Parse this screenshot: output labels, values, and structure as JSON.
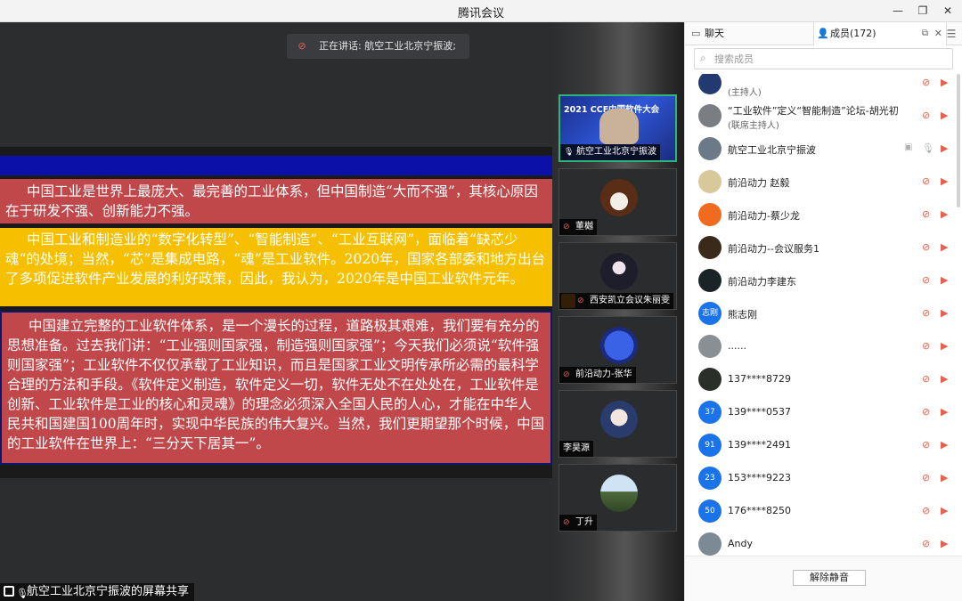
{
  "window": {
    "title": "腾讯会议"
  },
  "speaking": {
    "text": "正在讲话: 航空工业北京宁振波;"
  },
  "slide": {
    "p1": "中国工业是世界上最庞大、最完善的工业体系，但中国制造“大而不强”，其核心原因在于研发不强、创新能力不强。",
    "p2": "中国工业和制造业的“数字化转型”、“智能制造”、“工业互联网”，面临着“缺芯少魂“的处境；当然，“芯”是集成电路，“魂”是工业软件。2020年，国家各部委和地方出台了多项促进软件产业发展的利好政策，因此，我认为，2020年是中国工业软件元年。",
    "p3": "中国建立完整的工业软件体系，是一个漫长的过程，道路极其艰难，我们要有充分的思想准备。过去我们讲：“工业强则国家强，制造强则国家强”；今天我们必须说“软件强则国家强”；工业软件不仅仅承载了工业知识，而且是国家工业文明传承所必需的最科学合理的方法和手段。《软件定义制造，软件定义一切，软件无处不在处处在，工业软件是创新、工业软件是工业的核心和灵魂》的理念必须深入全国人民的人心，才能在中华人民共和国建国100周年时，实现中华民族的伟大复兴。当然，我们更期望那个时候，中国的工业软件在世界上：“三分天下居其一”。"
  },
  "share_label": "航空工业北京宁振波的屏幕共享",
  "video_tiles": [
    {
      "name": "航空工业北京宁振波",
      "conf_title": "2021 CCF中国软件大会"
    },
    {
      "name": "董樾"
    },
    {
      "name": "西安凯立会议朱丽雯"
    },
    {
      "name": "前沿动力-张华"
    },
    {
      "name": "李昊源"
    },
    {
      "name": "丁升"
    }
  ],
  "panel": {
    "tab_chat": "聊天",
    "tab_members": "成员(172)",
    "search_placeholder": "搜索成员",
    "unmute_label": "解除静音"
  },
  "members": [
    {
      "name": "",
      "role": "(主持人)",
      "color": "#233a70"
    },
    {
      "name": "“工业软件”定义“智能制造”论坛-胡光初",
      "role": "(联席主持人)",
      "color": "#7a7d82"
    },
    {
      "name": "航空工业北京宁振波",
      "color": "#6b7a86"
    },
    {
      "name": "前沿动力 赵毅",
      "color": "#d8c99a"
    },
    {
      "name": "前沿动力-蔡少龙",
      "color": "#f06a1f"
    },
    {
      "name": "前沿动力--会议服务1",
      "color": "#3a2a1a"
    },
    {
      "name": "前沿动力李建东",
      "color": "#1a2326"
    },
    {
      "name": "熊志刚",
      "avatar_text": "志刚",
      "color": "#1a73e8"
    },
    {
      "name": "......",
      "color": "#8a8f93"
    },
    {
      "name": "137****8729",
      "color": "#2a2f2a"
    },
    {
      "name": "139****0537",
      "avatar_text": "37",
      "color": "#1a73e8"
    },
    {
      "name": "139****2491",
      "avatar_text": "91",
      "color": "#1a73e8"
    },
    {
      "name": "153****9223",
      "avatar_text": "23",
      "color": "#1a73e8"
    },
    {
      "name": "176****8250",
      "avatar_text": "50",
      "color": "#1a73e8"
    },
    {
      "name": "Andy",
      "color": "#7c8a96"
    }
  ]
}
